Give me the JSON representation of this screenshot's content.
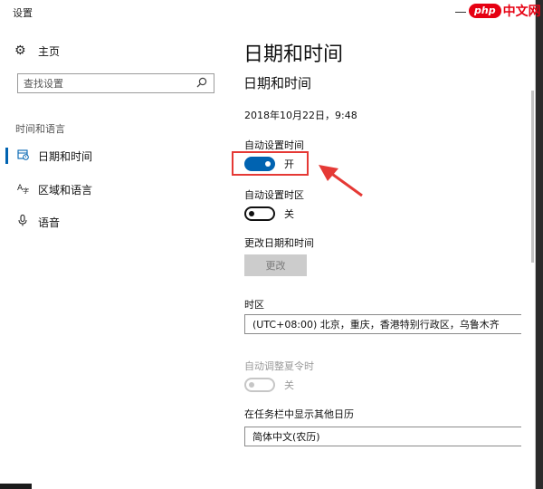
{
  "window": {
    "title": "设置"
  },
  "watermark": {
    "badge": "php",
    "text": "中文网"
  },
  "nav": {
    "home_label": "主页",
    "search_placeholder": "查找设置",
    "section_label": "时间和语言",
    "items": [
      {
        "label": "日期和时间",
        "icon": "calendar-clock-icon",
        "selected": true
      },
      {
        "label": "区域和语言",
        "icon": "region-language-icon",
        "selected": false
      },
      {
        "label": "语音",
        "icon": "microphone-icon",
        "selected": false
      }
    ]
  },
  "content": {
    "page_title": "日期和时间",
    "section_title": "日期和时间",
    "current_datetime": "2018年10月22日，9:48",
    "auto_time": {
      "label": "自动设置时间",
      "state": "开",
      "on": true
    },
    "auto_timezone": {
      "label": "自动设置时区",
      "state": "关",
      "on": false
    },
    "change_datetime": {
      "label": "更改日期和时间",
      "button": "更改"
    },
    "timezone": {
      "label": "时区",
      "value": "(UTC+08:00) 北京，重庆，香港特别行政区，乌鲁木齐"
    },
    "dst": {
      "label": "自动调整夏令时",
      "state": "关",
      "enabled": false
    },
    "other_calendar": {
      "label": "在任务栏中显示其他日历",
      "value": "简体中文(农历)"
    }
  },
  "colors": {
    "accent": "#0063b1",
    "annotation": "#e53935"
  }
}
